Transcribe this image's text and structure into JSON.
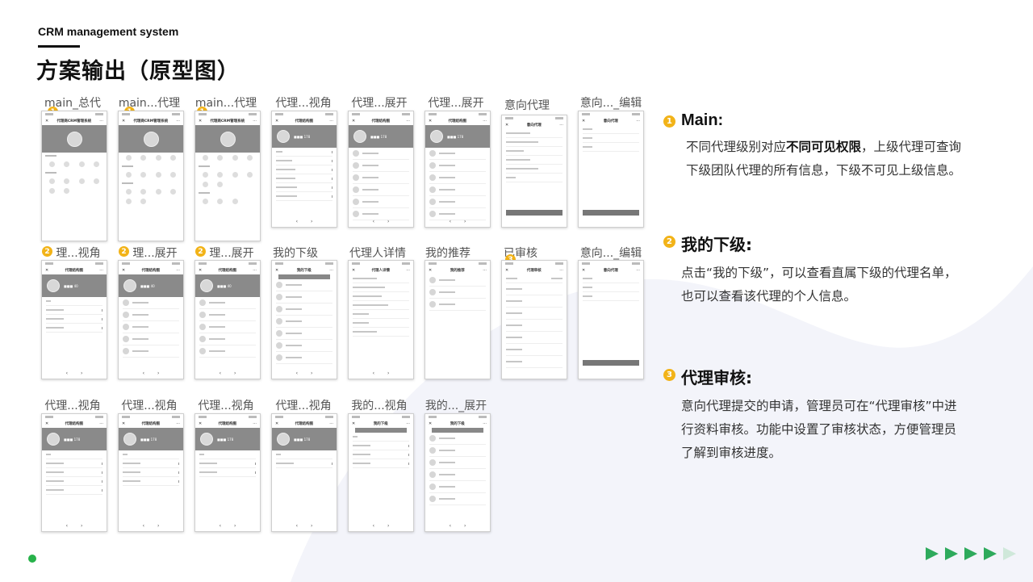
{
  "header": {
    "subtitle": "CRM management system",
    "title": "方案输出（原型图）"
  },
  "frames": [
    {
      "label": "main_总代",
      "badge": "1"
    },
    {
      "label": "main...代理",
      "badge": "1"
    },
    {
      "label": "main...代理",
      "badge": "1"
    },
    {
      "label": "代理...视角"
    },
    {
      "label": "代理...展开"
    },
    {
      "label": "代理...展开"
    },
    {
      "label": "意向代理"
    },
    {
      "label": "意向..._编辑"
    },
    {
      "label": "理...视角",
      "badge": "2"
    },
    {
      "label": "理...展开",
      "badge": "2"
    },
    {
      "label": "理...展开",
      "badge": "2"
    },
    {
      "label": "我的下级"
    },
    {
      "label": "代理人详情"
    },
    {
      "label": "我的推荐"
    },
    {
      "label": "已审核",
      "badge": "3"
    },
    {
      "label": "意向..._编辑"
    },
    {
      "label": "代理...视角"
    },
    {
      "label": "代理...视角"
    },
    {
      "label": "代理...视角"
    },
    {
      "label": "代理...视角"
    },
    {
      "label": "我的...视角"
    },
    {
      "label": "我的..._展开"
    }
  ],
  "descriptions": [
    {
      "number": "1",
      "title": "Main:",
      "lines": [
        [
          "不同代理级别对应",
          "不同可见权限",
          "，上级代理可查询"
        ],
        [
          "下级团队代理的所有信息，下级不可见上级信息。"
        ]
      ]
    },
    {
      "number": "2",
      "title": "我的下级:",
      "lines": [
        [
          "点击“我的下级”，可以查看直属下级的代理名单，"
        ],
        [
          "也可以查看该代理的个人信息。"
        ]
      ]
    },
    {
      "number": "3",
      "title": "代理审核:",
      "lines": [
        [
          "意向代理提交的申请，管理员可在“代理审核”中进"
        ],
        [
          "行资料审核。功能中设置了审核状态，方便管理员"
        ],
        [
          "了解到审核进度。"
        ]
      ]
    }
  ],
  "colors": {
    "accent": "#f2b318",
    "green": "#2eaa5c",
    "wave": "#f3f4fa"
  }
}
